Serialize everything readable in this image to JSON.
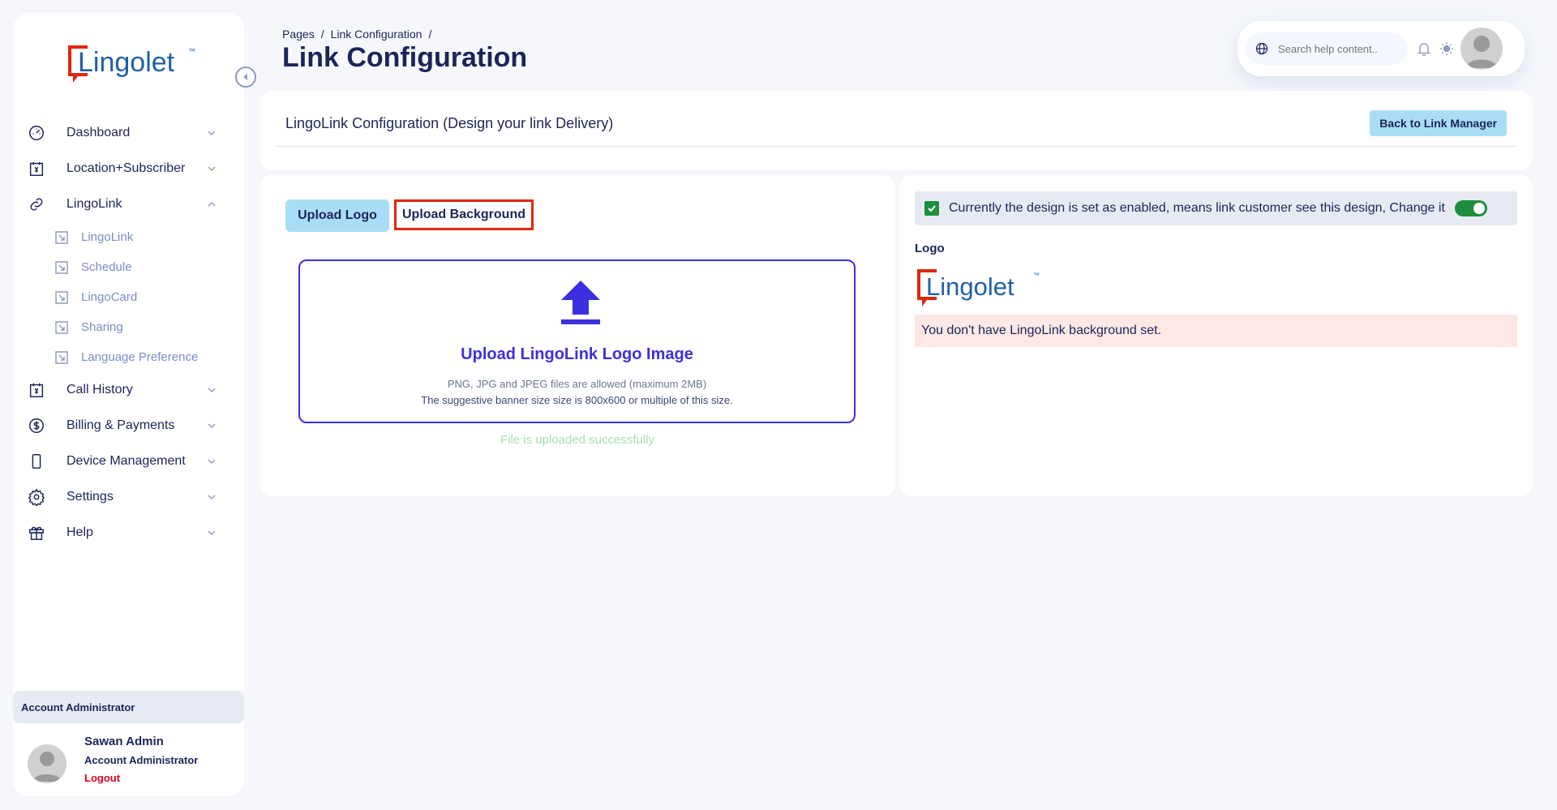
{
  "brand": {
    "name": "Lingolet",
    "tm": "™",
    "logo_red": "#e1260f",
    "logo_blue": "#1f5fa8"
  },
  "sidebar": {
    "items": [
      {
        "label": "Dashboard",
        "icon": "gauge-icon",
        "expanded": false
      },
      {
        "label": "Location+Subscriber",
        "icon": "calendar-icon",
        "expanded": false
      },
      {
        "label": "LingoLink",
        "icon": "link-icon",
        "expanded": true
      },
      {
        "label": "Call History",
        "icon": "calendar-icon",
        "expanded": false
      },
      {
        "label": "Billing & Payments",
        "icon": "dollar-icon",
        "expanded": false
      },
      {
        "label": "Device Management",
        "icon": "device-icon",
        "expanded": false
      },
      {
        "label": "Settings",
        "icon": "gear-icon",
        "expanded": false
      },
      {
        "label": "Help",
        "icon": "gift-icon",
        "expanded": false
      }
    ],
    "sub_items": [
      "LingoLink",
      "Schedule",
      "LingoCard",
      "Sharing",
      "Language Preference"
    ]
  },
  "account": {
    "header": "Account Administrator",
    "name": "Sawan Admin",
    "role": "Account Administrator",
    "logout": "Logout"
  },
  "header": {
    "breadcrumb": [
      "Pages",
      "/",
      "Link Configuration",
      "/"
    ],
    "title": "Link Configuration",
    "search_placeholder": "Search help content.."
  },
  "config_card": {
    "title": "LingoLink Configuration (Design your link Delivery)",
    "back_button": "Back to Link Manager"
  },
  "upload": {
    "tabs": [
      "Upload Logo",
      "Upload Background"
    ],
    "title": "Upload LingoLink Logo Image",
    "hint1": "PNG, JPG and JPEG files are allowed (maximum 2MB)",
    "hint2": "The suggestive banner size size is 800x600 or multiple of this size.",
    "success": "File is uploaded successfully"
  },
  "preview": {
    "status": "Currently the design is set as enabled, means link customer see this design, Change it",
    "enabled": true,
    "logo_label": "Logo",
    "alert": "You don't have LingoLink background set."
  },
  "colors": {
    "accent": "#3d2fe0",
    "tab_bg": "#a9ddf5",
    "success": "#a6dfb1",
    "toggle": "#1e8e3e",
    "alert_bg": "#fde8e6"
  }
}
